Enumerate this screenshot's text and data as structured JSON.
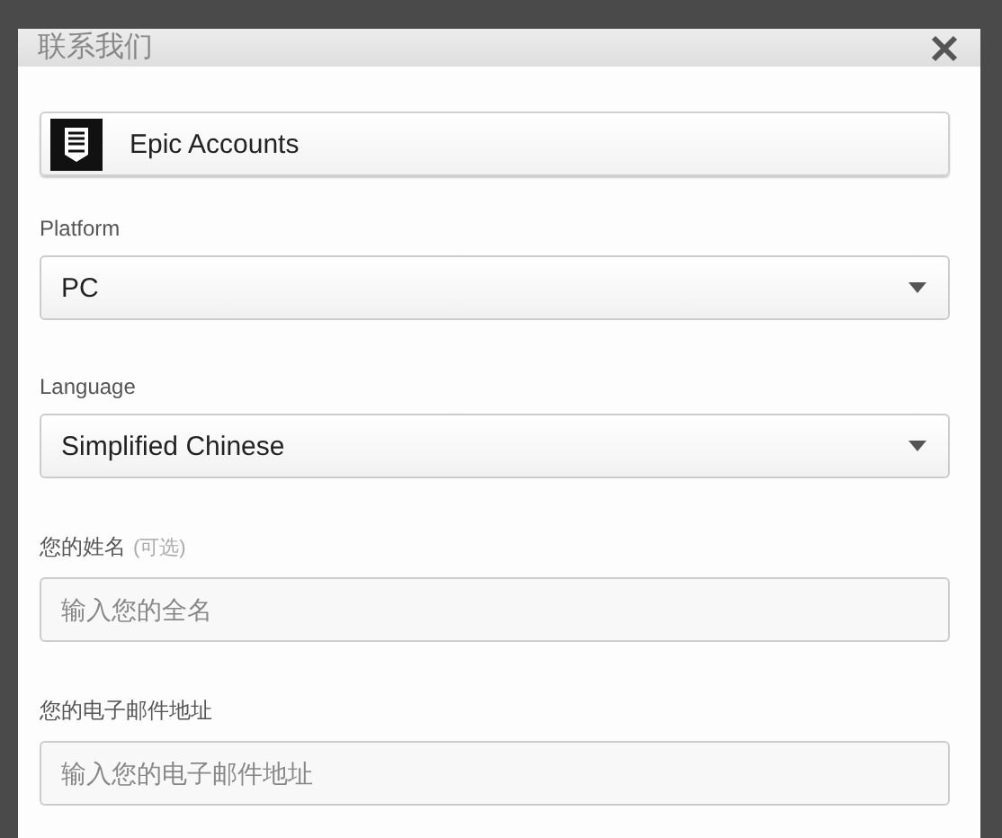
{
  "dialog": {
    "title": "联系我们"
  },
  "product": {
    "label": "Epic Accounts"
  },
  "fields": [
    {
      "kind": "select",
      "label": "Platform",
      "value": "PC"
    },
    {
      "kind": "select",
      "label": "Language",
      "value": "Simplified Chinese"
    },
    {
      "kind": "input",
      "label": "您的姓名",
      "note": "(可选)",
      "placeholder": "输入您的全名"
    },
    {
      "kind": "input",
      "label": "您的电子邮件地址",
      "placeholder": "输入您的电子邮件地址"
    }
  ]
}
